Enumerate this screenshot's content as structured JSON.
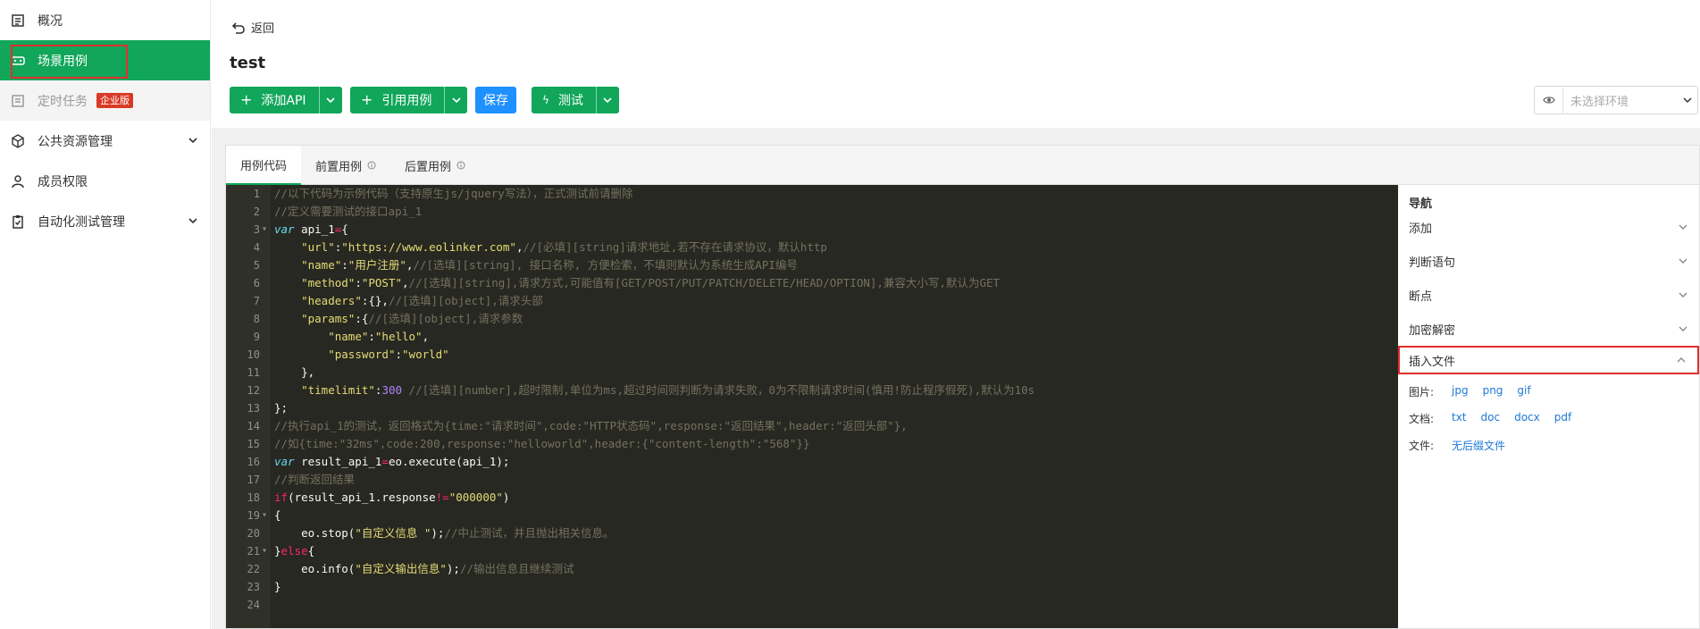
{
  "sidebar": {
    "items": [
      {
        "label": "概况",
        "icon": "dashboard-icon"
      },
      {
        "label": "场景用例",
        "icon": "case-icon"
      },
      {
        "label": "定时任务",
        "icon": "timer-icon",
        "badge": "企业版"
      },
      {
        "label": "公共资源管理",
        "icon": "cube-icon"
      },
      {
        "label": "成员权限",
        "icon": "user-icon"
      },
      {
        "label": "自动化测试管理",
        "icon": "clipboard-icon"
      }
    ]
  },
  "header": {
    "back_label": "返回",
    "title": "test",
    "add_api_label": "添加API",
    "ref_case_label": "引用用例",
    "save_label": "保存",
    "test_label": "测试",
    "env_placeholder": "未选择环境"
  },
  "tabs": [
    {
      "label": "用例代码"
    },
    {
      "label": "前置用例"
    },
    {
      "label": "后置用例"
    }
  ],
  "rnav": {
    "title": "导航",
    "sections": [
      "添加",
      "判断语句",
      "断点",
      "加密解密",
      "插入文件"
    ],
    "files": {
      "image_label": "图片:",
      "image_types": [
        "jpg",
        "png",
        "gif"
      ],
      "doc_label": "文档:",
      "doc_types": [
        "txt",
        "doc",
        "docx",
        "pdf"
      ],
      "file_label": "文件:",
      "file_types": [
        "无后缀文件"
      ]
    }
  },
  "colors": {
    "accent": "#11a65a",
    "blue": "#1e90ff",
    "highlight": "#e02f2f",
    "editor_bg": "#272822"
  }
}
